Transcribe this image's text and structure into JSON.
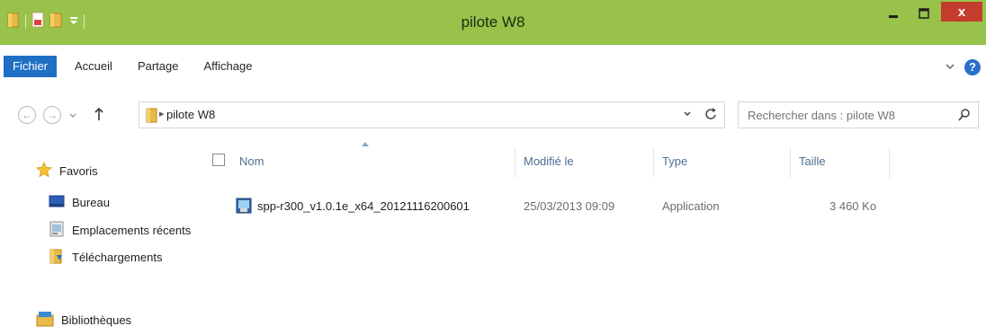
{
  "window": {
    "title": "pilote W8",
    "accent": "#98c24a",
    "close_label": "x"
  },
  "ribbon": {
    "tabs": [
      "Fichier",
      "Accueil",
      "Partage",
      "Affichage"
    ]
  },
  "address": {
    "path": "pilote W8",
    "search_placeholder": "Rechercher dans : pilote W8"
  },
  "navpane": {
    "favorites": "Favoris",
    "items": [
      "Bureau",
      "Emplacements récents",
      "Téléchargements"
    ],
    "libraries": "Bibliothèques"
  },
  "table": {
    "columns": [
      "Nom",
      "Modifié le",
      "Type",
      "Taille"
    ],
    "rows": [
      {
        "name": "spp-r300_v1.0.1e_x64_20121116200601",
        "modified": "25/03/2013 09:09",
        "type": "Application",
        "size": "3 460 Ko"
      }
    ]
  },
  "icons": {
    "folder": "folder-icon",
    "star": "star-icon",
    "desktop": "desktop-icon",
    "recent": "recent-places-icon",
    "downloads": "downloads-icon",
    "libraries": "libraries-icon",
    "app": "application-icon"
  }
}
